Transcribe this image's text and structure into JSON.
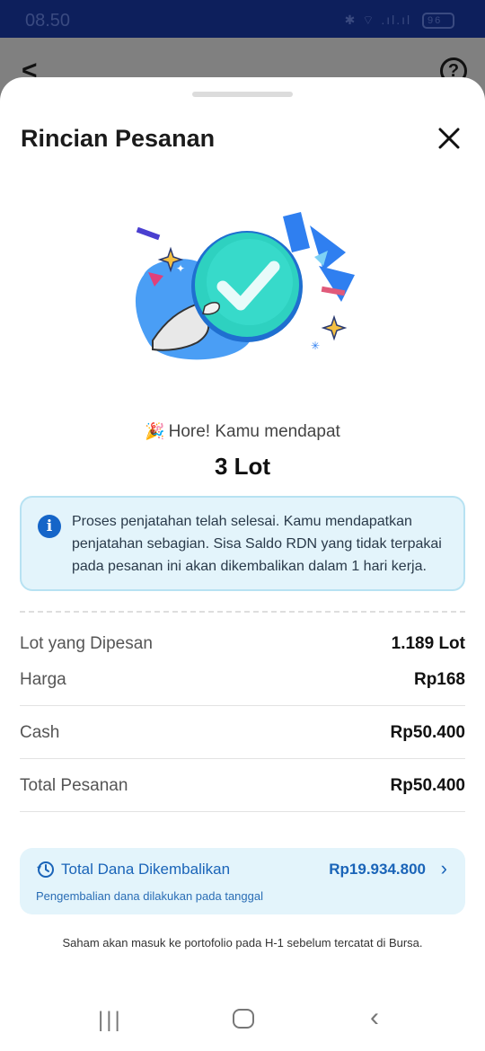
{
  "status_bar": {
    "time": "08.50",
    "battery": "96"
  },
  "sheet": {
    "title": "Rincian Pesanan"
  },
  "result": {
    "hore_text": "Hore! Kamu mendapat",
    "lot_text": "3 Lot"
  },
  "info": {
    "message": "Proses penjatahan telah selesai. Kamu mendapatkan penjatahan sebagian. Sisa Saldo RDN yang tidak terpakai pada pesanan ini akan dikembalikan dalam 1 hari kerja."
  },
  "details": [
    {
      "label": "Lot yang Dipesan",
      "value": "1.189 Lot"
    },
    {
      "label": "Harga",
      "value": "Rp168"
    },
    {
      "label": "Cash",
      "value": "Rp50.400"
    },
    {
      "label": "Total Pesanan",
      "value": "Rp50.400"
    }
  ],
  "refund": {
    "label": "Total Dana Dikembalikan",
    "amount": "Rp19.934.800",
    "note": "Pengembalian dana dilakukan pada tanggal"
  },
  "footer_note": "Saham akan masuk ke portofolio pada H-1 sebelum tercatat di Bursa.",
  "colors": {
    "accent": "#1a64b8",
    "info_bg": "#e3f4fb",
    "check_teal": "#2ed1c0",
    "status_bar": "#0d1f5c"
  }
}
